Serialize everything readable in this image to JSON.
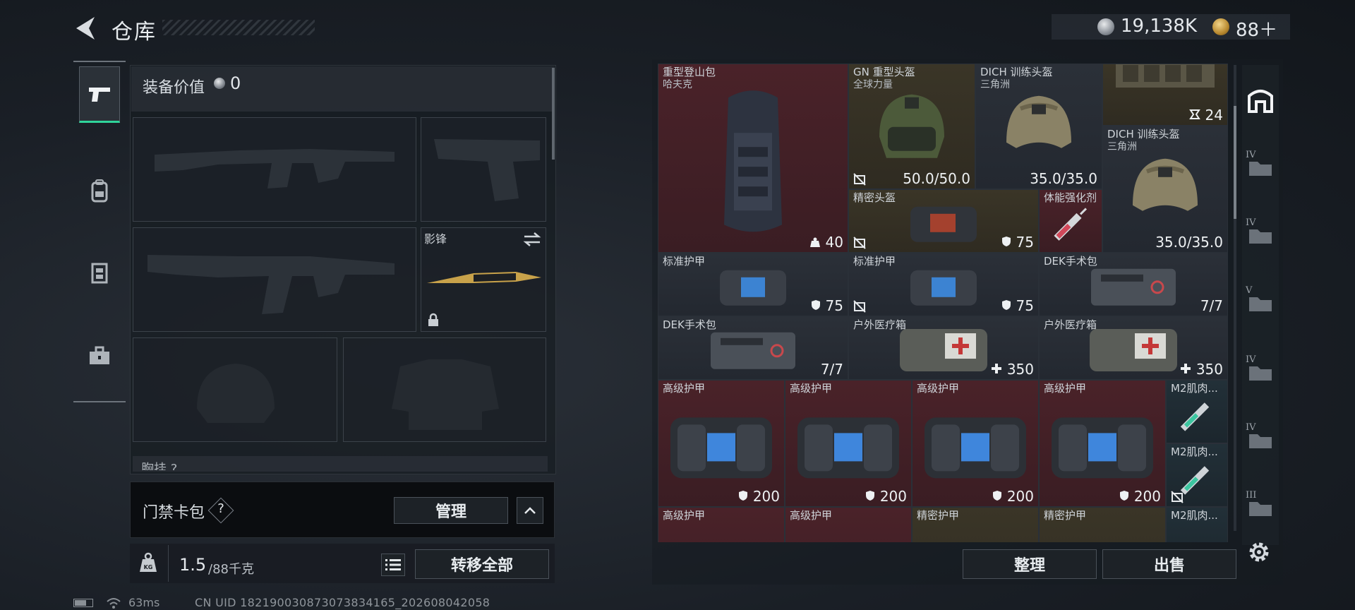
{
  "header": {
    "title": "仓库",
    "currency": {
      "coins": "19,138K",
      "gold": "88＋"
    }
  },
  "equipment": {
    "value_label": "装备价值",
    "value": "0",
    "melee_name": "影锋",
    "chest_rig_label": "胸挂 ?"
  },
  "keycard": {
    "label": "门禁卡包",
    "help": "?",
    "manage_label": "管理"
  },
  "weight": {
    "current": "1.5",
    "capacity": "/88千克",
    "transfer_all_label": "转移全部"
  },
  "status": {
    "ping": "63ms",
    "uid": "CN UID 1821900308730738341​65_202608042058"
  },
  "stash": {
    "items": [
      {
        "name": "重型登山包",
        "sub": "哈夫克",
        "stat": "40",
        "stat_icon": "weight-icon",
        "bg": "red"
      },
      {
        "name": "GN 重型头盔",
        "sub": "全球力量",
        "stat": "50.0/50.0",
        "bg": "olive",
        "locked": true
      },
      {
        "name": "DICH 训练头盔",
        "sub": "三角洲",
        "stat": "35.0/35.0",
        "bg": "gray"
      },
      {
        "name": "",
        "sub": "",
        "stat": "24",
        "bg": "olive"
      },
      {
        "name": "DICH 训练头盔",
        "sub": "三角洲",
        "stat": "35.0/35.0",
        "bg": "gray"
      },
      {
        "name": "精密头盔",
        "stat": "75",
        "bg": "olive",
        "locked": true
      },
      {
        "name": "体能强化剂",
        "bg": "red"
      },
      {
        "name": "标准护甲",
        "stat": "75",
        "bg": "gray"
      },
      {
        "name": "标准护甲",
        "stat": "75",
        "bg": "gray",
        "locked": true
      },
      {
        "name": "DEK手术包",
        "stat": "7/7",
        "bg": "gray"
      },
      {
        "name": "DEK手术包",
        "stat": "7/7",
        "bg": "gray"
      },
      {
        "name": "户外医疗箱",
        "stat": "350",
        "bg": "gray"
      },
      {
        "name": "户外医疗箱",
        "stat": "350",
        "bg": "gray"
      },
      {
        "name": "高级护甲",
        "stat": "200",
        "bg": "red"
      },
      {
        "name": "高级护甲",
        "stat": "200",
        "bg": "red"
      },
      {
        "name": "高级护甲",
        "stat": "200",
        "bg": "red"
      },
      {
        "name": "高级护甲",
        "stat": "200",
        "bg": "red"
      },
      {
        "name": "M2肌肉...",
        "bg": "teal"
      },
      {
        "name": "M2肌肉...",
        "bg": "teal",
        "locked": true
      },
      {
        "name": "高级护甲",
        "bg": "red"
      },
      {
        "name": "高级护甲",
        "bg": "red"
      },
      {
        "name": "精密护甲",
        "bg": "olive"
      },
      {
        "name": "精密护甲",
        "bg": "olive"
      },
      {
        "name": "M2肌肉...",
        "bg": "teal"
      }
    ],
    "sort_label": "整理",
    "sell_label": "出售"
  },
  "right_rail": {
    "tiers": [
      "IV",
      "IV",
      "V",
      "IV",
      "IV",
      "III"
    ]
  }
}
